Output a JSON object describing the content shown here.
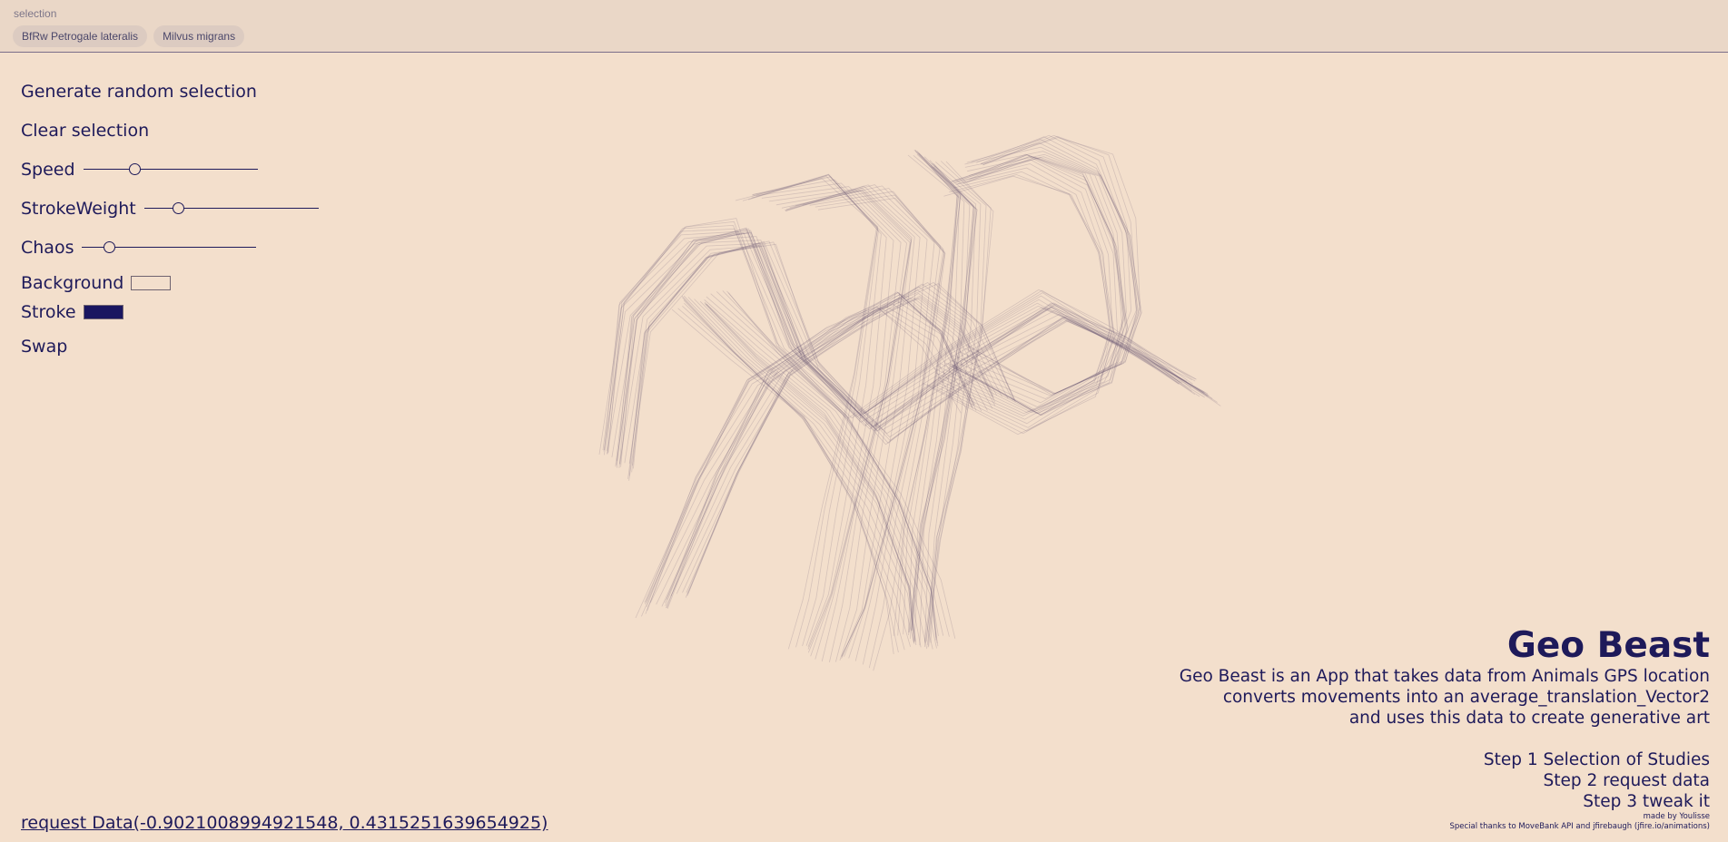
{
  "topbar": {
    "label": "selection",
    "chips": [
      "BfRw Petrogale lateralis",
      "Milvus migrans"
    ]
  },
  "controls": {
    "generate_label": "Generate random selection",
    "clear_label": "Clear selection",
    "speed": {
      "label": "Speed",
      "value": 0.3
    },
    "stroke_weight": {
      "label": "StrokeWeight",
      "value": 0.2
    },
    "chaos": {
      "label": "Chaos",
      "value": 0.16
    },
    "background": {
      "label": "Background",
      "color": "#f3dfcc"
    },
    "stroke": {
      "label": "Stroke",
      "color": "#1a1660"
    },
    "swap_label": "Swap"
  },
  "info": {
    "title": "Geo Beast",
    "desc_1": "Geo Beast is an App that takes data from Animals GPS location",
    "desc_2": "converts movements into an average_translation_Vector2",
    "desc_3": "and uses this data to create generative art",
    "step_1": "Step 1 Selection of Studies",
    "step_2": "Step 2 request data",
    "step_3": "Step 3 tweak it",
    "credit": "made by Youlisse",
    "thanks": "Special thanks to MoveBank API and jfirebaugh (jfire.io/animations)"
  },
  "request": {
    "label": "request Data(-0.9021008994921548, 0.4315251639654925)"
  },
  "colors": {
    "background": "#f3dfcc",
    "topbar": "#ead7c7",
    "accent": "#1e1a5a",
    "art_stroke": "#6f5a78"
  }
}
